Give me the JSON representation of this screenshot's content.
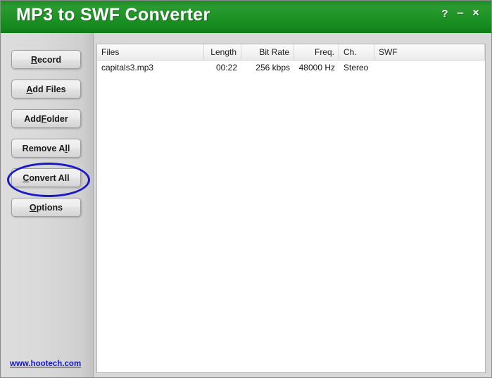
{
  "window": {
    "title": "MP3 to SWF Converter",
    "title_bar_color": "#1f9226",
    "controls": {
      "help": "?",
      "minimize": "–",
      "close": "×"
    }
  },
  "sidebar": {
    "buttons": [
      {
        "label": "Record",
        "accel_before": "",
        "accel": "R",
        "accel_after": "ecord"
      },
      {
        "label": "Add Files",
        "accel_before": "",
        "accel": "A",
        "accel_after": "dd Files"
      },
      {
        "label": "Add Folder",
        "accel_before": "Add ",
        "accel": "F",
        "accel_after": "older"
      },
      {
        "label": "Remove All",
        "accel_before": "Remove A",
        "accel": "l",
        "accel_after": "l"
      },
      {
        "label": "Convert All",
        "accel_before": "",
        "accel": "C",
        "accel_after": "onvert All"
      },
      {
        "label": "Options",
        "accel_before": "",
        "accel": "O",
        "accel_after": "ptions"
      }
    ],
    "annotation": {
      "target": "Convert All",
      "shape": "ellipse",
      "color": "#1a1ac4"
    },
    "link": {
      "label": "www.hootech.com",
      "color": "#1414d2"
    }
  },
  "list_view": {
    "columns": [
      {
        "label": "Files",
        "align": "left"
      },
      {
        "label": "Length",
        "align": "right"
      },
      {
        "label": "Bit Rate",
        "align": "right"
      },
      {
        "label": "Freq.",
        "align": "right"
      },
      {
        "label": "Ch.",
        "align": "left"
      },
      {
        "label": "SWF",
        "align": "left"
      }
    ],
    "rows": [
      {
        "files": "capitals3.mp3",
        "length": "00:22",
        "bit_rate": "256 kbps",
        "freq": "48000 Hz",
        "ch": "Stereo",
        "swf": ""
      }
    ]
  }
}
